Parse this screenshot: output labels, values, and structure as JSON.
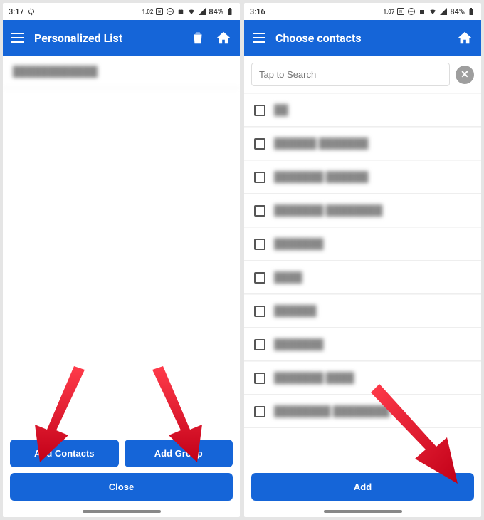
{
  "left": {
    "status": {
      "time": "3:17",
      "battery": "84%",
      "kbs": "1.02"
    },
    "title": "Personalized List",
    "list_item": "████████████",
    "buttons": {
      "add_contacts": "Add Contacts",
      "add_group": "Add Group",
      "close": "Close"
    }
  },
  "right": {
    "status": {
      "time": "3:16",
      "battery": "84%",
      "kbs": "1.07"
    },
    "title": "Choose contacts",
    "search_placeholder": "Tap to Search",
    "contacts": [
      "██",
      "██████ ███████",
      "███████ ██████",
      "███████ ████████",
      "███████",
      "████",
      "██████",
      "███████",
      "███████ ████",
      "████████ ████████"
    ],
    "add_button": "Add"
  }
}
